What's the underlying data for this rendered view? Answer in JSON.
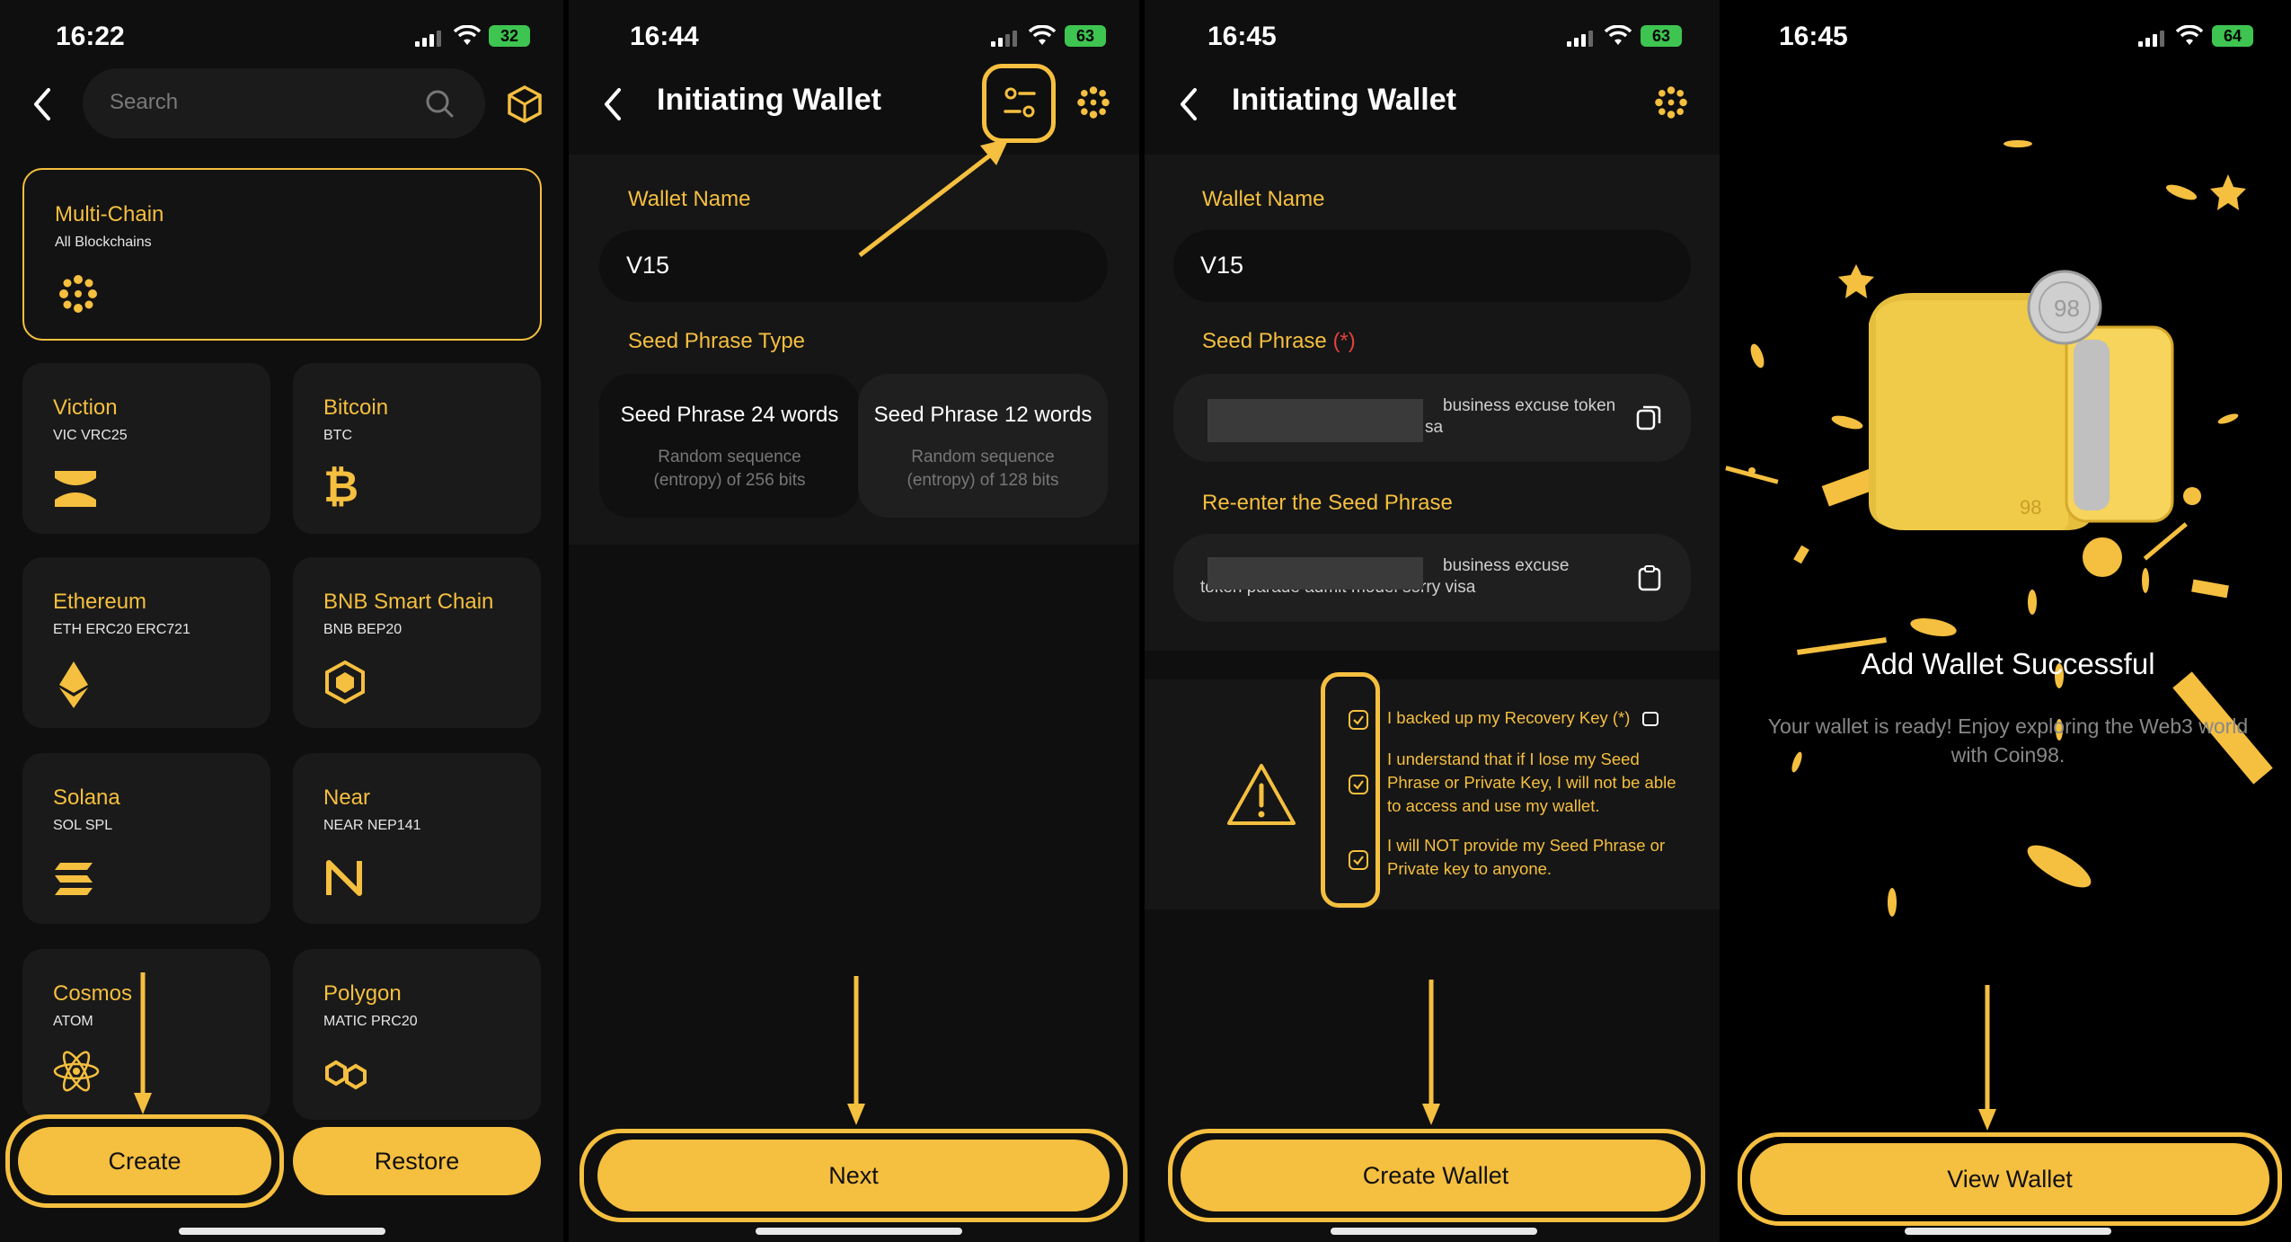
{
  "colors": {
    "accent": "#f5bf3f",
    "background": "#0f0f0f",
    "card": "#1a1a1a",
    "battery": "#3ec450",
    "required": "#e2413c"
  },
  "screen1": {
    "time": "16:22",
    "battery": "32",
    "search_placeholder": "Search",
    "chains": [
      {
        "name": "Multi-Chain",
        "sub": "All Blockchains",
        "icon": "coin98-dots-icon"
      },
      {
        "name": "Viction",
        "sub": "VIC VRC25",
        "icon": "viction-icon"
      },
      {
        "name": "Bitcoin",
        "sub": "BTC",
        "icon": "bitcoin-icon"
      },
      {
        "name": "Ethereum",
        "sub": "ETH ERC20 ERC721",
        "icon": "ethereum-icon"
      },
      {
        "name": "BNB Smart Chain",
        "sub": "BNB BEP20",
        "icon": "bnb-icon"
      },
      {
        "name": "Solana",
        "sub": "SOL SPL",
        "icon": "solana-icon"
      },
      {
        "name": "Near",
        "sub": "NEAR NEP141",
        "icon": "near-icon"
      },
      {
        "name": "Cosmos",
        "sub": "ATOM",
        "icon": "cosmos-icon"
      },
      {
        "name": "Polygon",
        "sub": "MATIC PRC20",
        "icon": "polygon-icon"
      }
    ],
    "create_label": "Create",
    "restore_label": "Restore"
  },
  "screen2": {
    "time": "16:44",
    "battery": "63",
    "title": "Initiating Wallet",
    "wallet_name_label": "Wallet Name",
    "wallet_name_value": "V15",
    "seed_type_label": "Seed Phrase Type",
    "options": [
      {
        "title": "Seed Phrase 24 words",
        "desc1": "Random sequence",
        "desc2": "(entropy) of 256 bits"
      },
      {
        "title": "Seed Phrase 12 words",
        "desc1": "Random sequence",
        "desc2": "(entropy) of 128 bits"
      }
    ],
    "next_label": "Next"
  },
  "screen3": {
    "time": "16:45",
    "battery": "63",
    "title": "Initiating Wallet",
    "wallet_name_label": "Wallet Name",
    "wallet_name_value": "V15",
    "seed_label": "Seed Phrase",
    "required_mark": "(*)",
    "seed_line1": "business excuse token",
    "seed_line2": "sa",
    "reenter_label": "Re-enter the Seed Phrase",
    "reenter_line1": "business excuse",
    "reenter_line2": "token parade admit model sorry visa",
    "checks": [
      "I backed up my Recovery Key (*)",
      "I understand that if I lose my Seed Phrase or Private Key, I will not be able to access and use my wallet.",
      "I will NOT provide my Seed Phrase or Private key to anyone."
    ],
    "create_wallet_label": "Create Wallet"
  },
  "screen4": {
    "time": "16:45",
    "battery": "64",
    "success_title": "Add Wallet Successful",
    "success_line1": "Your wallet is ready! Enjoy exploring the Web3 world",
    "success_line2": "with Coin98.",
    "view_wallet_label": "View Wallet"
  }
}
